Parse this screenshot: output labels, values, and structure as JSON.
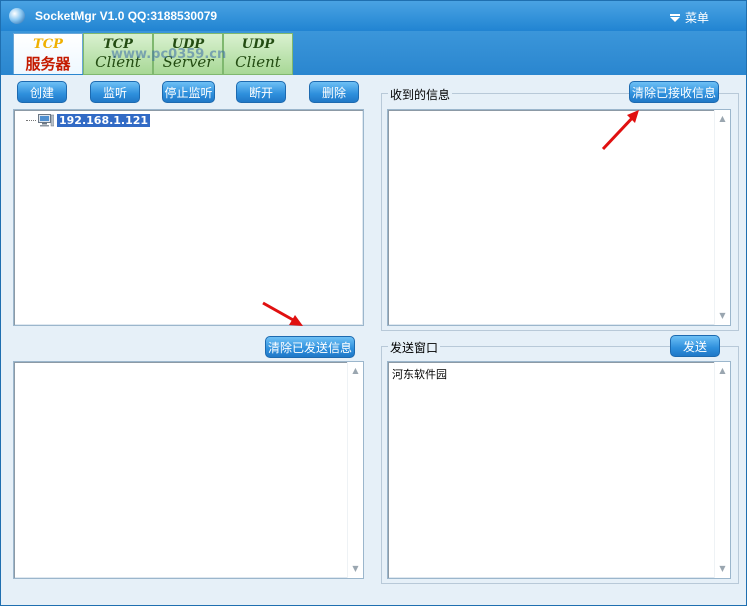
{
  "window": {
    "title": "SocketMgr V1.0  QQ:3188530079",
    "menu_label": "菜单"
  },
  "tabs": [
    {
      "line1": "TCP",
      "line2": "服务器"
    },
    {
      "line1": "TCP",
      "line2": "Client"
    },
    {
      "line1": "UDP",
      "line2": "Server"
    },
    {
      "line1": "UDP",
      "line2": "Client"
    }
  ],
  "watermark": "www.pc0359.cn",
  "toolbar": {
    "create": "创建",
    "listen": "监听",
    "stop_listen": "停止监听",
    "disconnect": "断开",
    "delete": "删除"
  },
  "client_list": {
    "items": [
      {
        "ip": "192.168.1.121"
      }
    ]
  },
  "sent": {
    "clear_button": "清除已发送信息",
    "text": ""
  },
  "received": {
    "group_label": "收到的信息",
    "clear_button": "清除已接收信息",
    "text": ""
  },
  "send_window": {
    "group_label": "发送窗口",
    "send_button": "发送",
    "text": "河东软件园"
  },
  "colors": {
    "title_bar": "#2184d2",
    "button": "#2e8fdc",
    "selection": "#316ac5",
    "annotation_arrow": "#e01010"
  }
}
